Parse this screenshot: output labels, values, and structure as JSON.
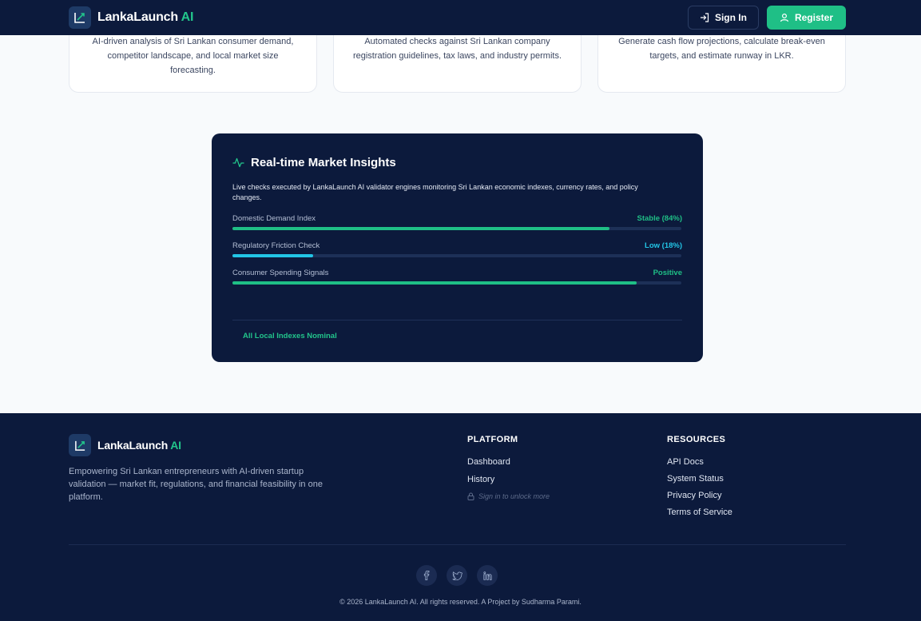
{
  "header": {
    "brand_name": "LankaLaunch",
    "brand_accent": "AI",
    "signin_label": "Sign In",
    "register_label": "Register",
    "logo_icon": "trending-up-icon"
  },
  "features": [
    {
      "text": "AI-driven analysis of Sri Lankan consumer demand, competitor landscape, and local market size forecasting."
    },
    {
      "text": "Automated checks against Sri Lankan company registration guidelines, tax laws, and industry permits."
    },
    {
      "text": "Generate cash flow projections, calculate break-even targets, and estimate runway in LKR."
    }
  ],
  "insights": {
    "title": "Real-time Market Insights",
    "description": "Live checks executed by LankaLaunch AI validator engines monitoring Sri Lankan economic indexes, currency rates, and policy changes.",
    "metrics": [
      {
        "label": "Domestic Demand Index",
        "value": "Stable (84%)",
        "fill": 0.84,
        "color": "#1fbf86"
      },
      {
        "label": "Regulatory Friction Check",
        "value": "Low (18%)",
        "fill": 0.18,
        "color": "#22c5e6"
      },
      {
        "label": "Consumer Spending Signals",
        "value": "Positive",
        "fill": 0.9,
        "color": "#1fbf86"
      }
    ],
    "status": "All Local Indexes Nominal"
  },
  "footer": {
    "brand_name": "LankaLaunch",
    "brand_accent": "AI",
    "description": "Empowering Sri Lankan entrepreneurs with AI-driven startup validation — market fit, regulations, and financial feasibility in one platform.",
    "platform": {
      "heading": "PLATFORM",
      "links": [
        "Dashboard",
        "History"
      ],
      "locked_note": "Sign in to unlock more"
    },
    "resources": {
      "heading": "RESOURCES",
      "links": [
        "API Docs",
        "System Status",
        "Privacy Policy",
        "Terms of Service"
      ]
    },
    "socials": [
      "facebook-icon",
      "twitter-icon",
      "linkedin-icon"
    ],
    "copyright": "© 2026 LankaLaunch AI. All rights reserved. A Project by Sudharma Parami."
  },
  "colors": {
    "navy": "#0c1a3c",
    "accent": "#1fbf86",
    "cyan": "#22c5e6"
  }
}
